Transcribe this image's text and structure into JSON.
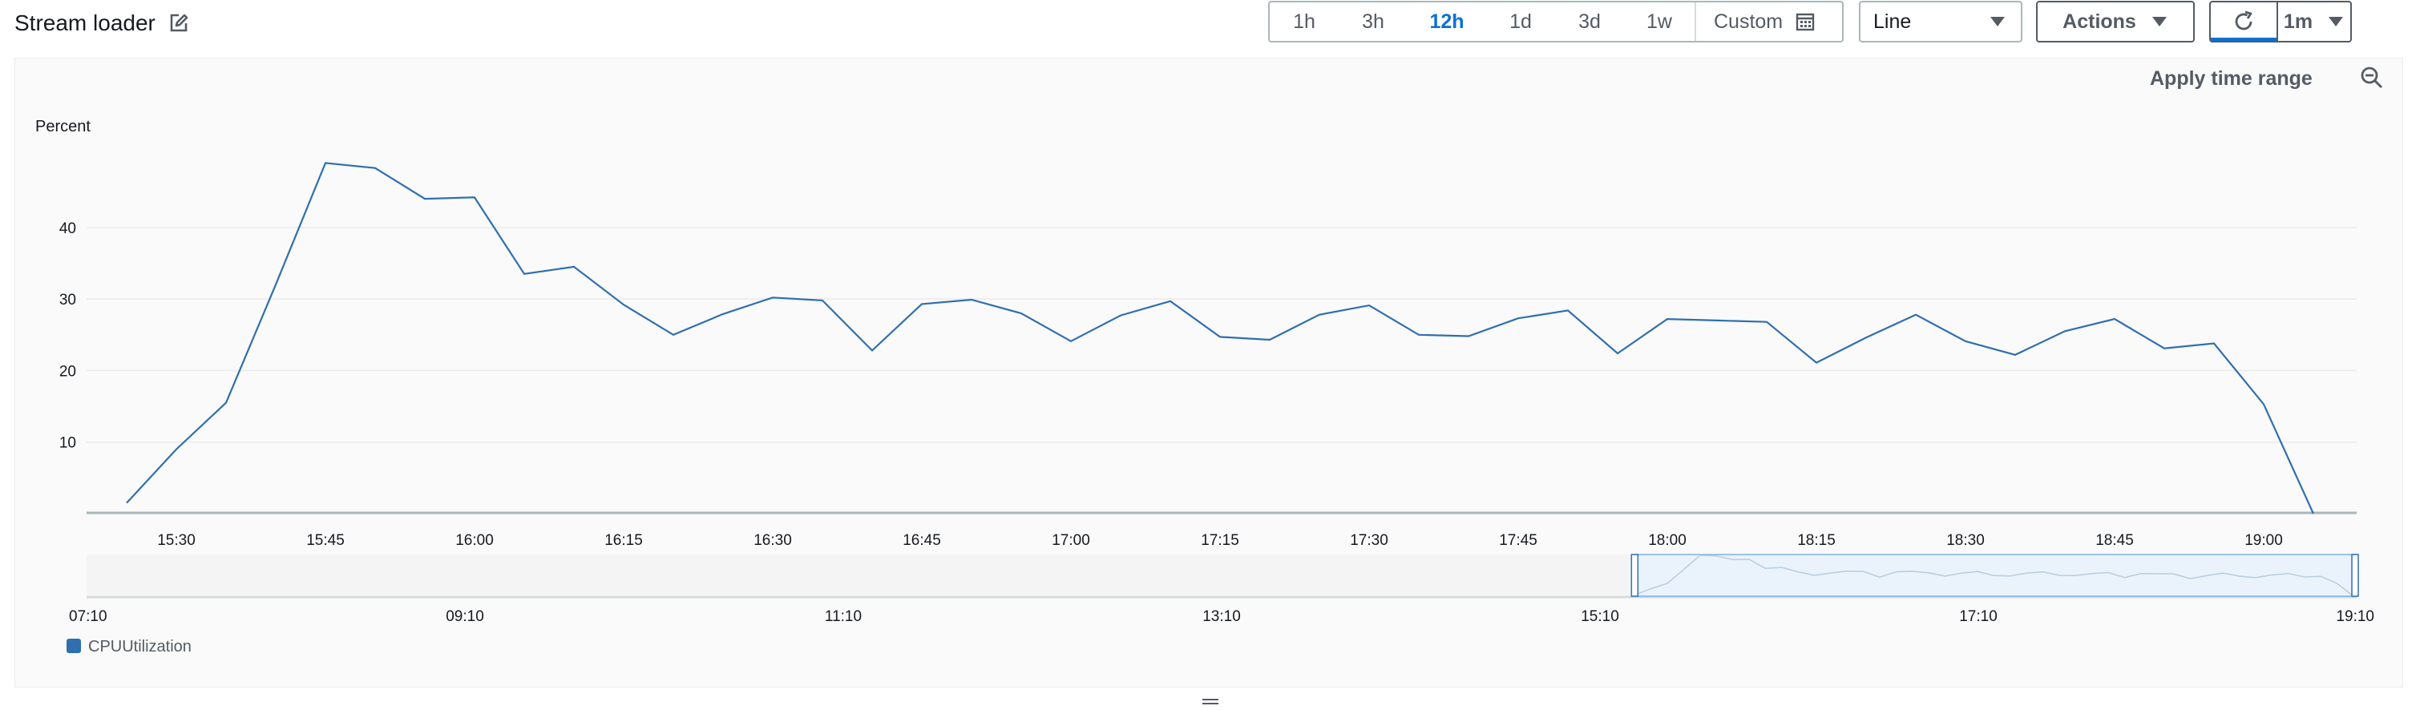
{
  "header": {
    "title": "Stream loader",
    "edit_icon": "edit-icon"
  },
  "time_range": {
    "buttons": [
      "1h",
      "3h",
      "12h",
      "1d",
      "3d",
      "1w"
    ],
    "active": "12h",
    "custom_label": "Custom",
    "custom_icon": "calendar-icon"
  },
  "chart_type_select": {
    "value": "Line",
    "icon": "caret-down-icon"
  },
  "actions": {
    "label": "Actions",
    "icon": "caret-down-icon"
  },
  "refresh": {
    "icon": "refresh-icon",
    "interval": "1m"
  },
  "panel": {
    "apply_label": "Apply time range",
    "zoom_icon": "zoom-out-icon"
  },
  "colors": {
    "series": "#2f6fb0",
    "accent": "#0972d3",
    "grid": "#e9ebed"
  },
  "chart_data": {
    "type": "line",
    "title": "",
    "ylabel": "Percent",
    "xlabel": "",
    "ylim": [
      0,
      50
    ],
    "yticks": [
      10,
      20,
      30,
      40
    ],
    "xticks": [
      "15:30",
      "15:45",
      "16:00",
      "16:15",
      "16:30",
      "16:45",
      "17:00",
      "17:15",
      "17:30",
      "17:45",
      "18:00",
      "18:15",
      "18:30",
      "18:45",
      "19:00"
    ],
    "grid": true,
    "legend_position": "bottom-left",
    "series": [
      {
        "name": "CPUUtilization",
        "x": [
          "15:25",
          "15:30",
          "15:35",
          "15:40",
          "15:45",
          "15:50",
          "15:55",
          "16:00",
          "16:05",
          "16:10",
          "16:15",
          "16:20",
          "16:25",
          "16:30",
          "16:35",
          "16:40",
          "16:45",
          "16:50",
          "16:55",
          "17:00",
          "17:05",
          "17:10",
          "17:15",
          "17:20",
          "17:25",
          "17:30",
          "17:35",
          "17:40",
          "17:45",
          "17:50",
          "17:55",
          "18:00",
          "18:05",
          "18:10",
          "18:15",
          "18:20",
          "18:25",
          "18:30",
          "18:35",
          "18:40",
          "18:45",
          "18:50",
          "18:55",
          "19:00",
          "19:05"
        ],
        "values": [
          1.5,
          9,
          15.5,
          32,
          49,
          48.3,
          44,
          44.2,
          33.5,
          34.5,
          29.2,
          25,
          27.9,
          30.2,
          29.8,
          22.8,
          29.3,
          29.9,
          28,
          24.1,
          27.7,
          29.7,
          24.7,
          24.3,
          27.8,
          29.1,
          25,
          24.8,
          27.3,
          28.4,
          22.4,
          27.2,
          27,
          26.8,
          21.1,
          24.6,
          27.8,
          24.1,
          22.2,
          25.5,
          27.2,
          23.1,
          23.8,
          15.3,
          0
        ]
      }
    ]
  },
  "overview": {
    "labels": [
      "07:10",
      "09:10",
      "11:10",
      "13:10",
      "15:10",
      "17:10",
      "19:10"
    ],
    "selected_range": [
      "15:20",
      "19:10"
    ]
  }
}
